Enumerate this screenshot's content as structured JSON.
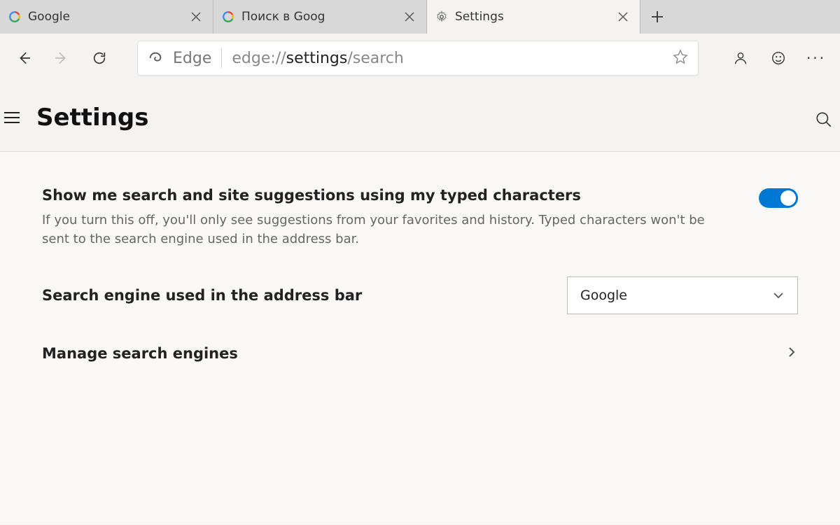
{
  "tabs": [
    {
      "title": "Google",
      "icon": "google"
    },
    {
      "title": "Поиск в Goog",
      "icon": "google"
    },
    {
      "title": "Settings",
      "icon": "gear",
      "active": true
    }
  ],
  "addressbar": {
    "scheme_label": "Edge",
    "url_prefix": "edge://",
    "url_path_bold": "settings",
    "url_suffix": "/search"
  },
  "header": {
    "title": "Settings"
  },
  "settings": {
    "suggestions": {
      "label": "Show me search and site suggestions using my typed characters",
      "description": "If you turn this off, you'll only see suggestions from your favorites and history. Typed characters won't be sent to the search engine used in the address bar.",
      "enabled": true
    },
    "search_engine": {
      "label": "Search engine used in the address bar",
      "selected": "Google"
    },
    "manage": {
      "label": "Manage search engines"
    }
  }
}
